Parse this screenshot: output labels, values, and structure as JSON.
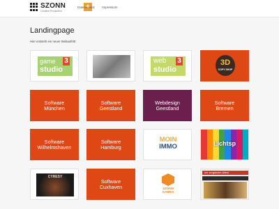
{
  "header": {
    "brand_name": "SZONN",
    "brand_sub": "Creative Produktion",
    "plus_symbol": "+",
    "nav": [
      "Datenschutz",
      "Impressum"
    ]
  },
  "page": {
    "title": "Landingpage",
    "intro": "Hier entsteht ein neuer Webauftritt"
  },
  "tiles": [
    {
      "kind": "logo",
      "name": "game3studio",
      "text1": "game",
      "text2": "studio",
      "num": "3"
    },
    {
      "kind": "image",
      "name": "photo-collage"
    },
    {
      "kind": "logo",
      "name": "web3studio",
      "text1": "web",
      "text2": "studio",
      "num": "3"
    },
    {
      "kind": "logo",
      "name": "3d-copy-shop",
      "text1": "3D",
      "text2": "COPY SHOP"
    },
    {
      "kind": "text",
      "label": "Software\nMünchen"
    },
    {
      "kind": "text",
      "label": "Software\nGeestland"
    },
    {
      "kind": "text",
      "label": "Webdesign\nGeestland"
    },
    {
      "kind": "text",
      "label": "Software\nBremen"
    },
    {
      "kind": "text",
      "label": "Software\nWilhelmshaven"
    },
    {
      "kind": "text",
      "label": "Software\nHamburg"
    },
    {
      "kind": "logo",
      "name": "moin-immo",
      "text1": "MOIN",
      "text2": "IMMO"
    },
    {
      "kind": "logo",
      "name": "lichtspiel",
      "text1": "Lichtsp"
    },
    {
      "kind": "logo",
      "name": "cyresy",
      "text1": "CYRESY"
    },
    {
      "kind": "text",
      "label": "Software\nCuxhaven"
    },
    {
      "kind": "logo",
      "name": "szonn-games",
      "text1": "SZONN\nGAMES"
    },
    {
      "kind": "logo",
      "name": "shop-banner",
      "text1": "ich vergleiche Alles!"
    }
  ],
  "colors": {
    "accent_orange": "#dd4814",
    "accent_purple": "#6b1f4c",
    "brand_plus": "#f0a030"
  }
}
